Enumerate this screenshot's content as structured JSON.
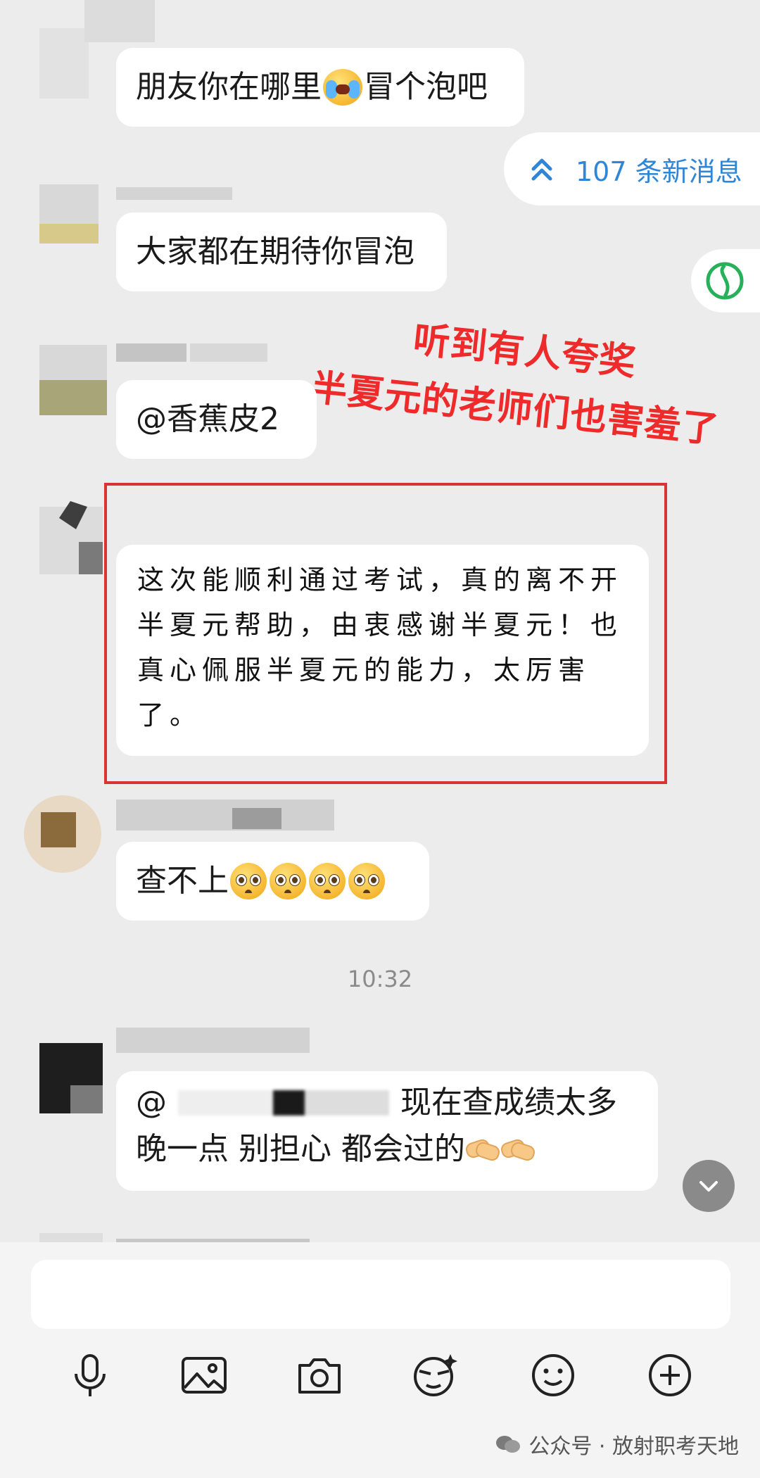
{
  "messages": [
    {
      "text_before": "朋友你在哪里",
      "text_after": "冒个泡吧",
      "emoji": "crying-face"
    },
    {
      "text": "大家都在期待你冒泡"
    },
    {
      "text": "@香蕉皮2"
    },
    {
      "lines": [
        "这次能顺利通过考试，真的离不开",
        "半夏元帮助，由衷感谢半夏元！也",
        "真心佩服半夏元的能力，太厉害",
        "了。"
      ]
    },
    {
      "text": "查不上",
      "emoji_count": 4,
      "emoji": "pleading-face"
    },
    {
      "mention": "@",
      "text_line1": "现在查成绩太多",
      "text_line2": "晚一点  别担心  都会过的",
      "emoji": "handshake"
    }
  ],
  "new_messages_label": "107 条新消息",
  "annotation": {
    "line1": "听到有人夸奖",
    "line2": "半夏元的老师们也害羞了"
  },
  "timestamp": "10:32",
  "toolbar": [
    "microphone-icon",
    "image-icon",
    "camera-icon",
    "sticker-icon",
    "emoji-icon",
    "plus-icon"
  ],
  "watermark": "公众号 · 放射职考天地",
  "colors": {
    "background": "#ececec",
    "bubble": "#ffffff",
    "link": "#2f86d6",
    "highlight": "#d83434",
    "annotation": "#ee2a2a"
  }
}
